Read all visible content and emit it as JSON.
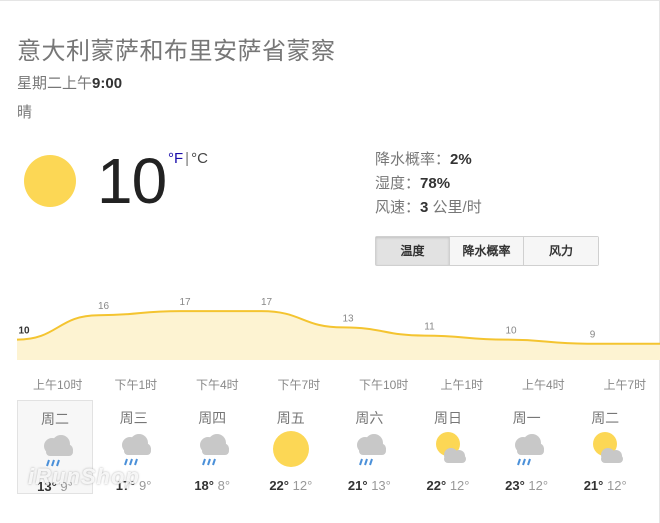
{
  "location": "意大利蒙萨和布里安萨省蒙察",
  "datetime": {
    "prefix": "星期二上午",
    "time": "9:00"
  },
  "condition": "晴",
  "current": {
    "icon": "sun-icon",
    "temperature": "10",
    "unit_f": "°F",
    "unit_sep": "|",
    "unit_c": "°C"
  },
  "details": {
    "precip_label": "降水概率：",
    "precip_value": "2%",
    "humidity_label": "湿度：",
    "humidity_value": "78%",
    "wind_label": "风速：",
    "wind_value": "3",
    "wind_unit": "公里/时"
  },
  "tabs": [
    "温度",
    "降水概率",
    "风力"
  ],
  "active_tab": "温度",
  "chart_data": {
    "type": "area",
    "x": [
      "上午10时",
      "下午1时",
      "下午4时",
      "下午7时",
      "下午10时",
      "上午1时",
      "上午4时",
      "上午7时"
    ],
    "y_points": [
      10,
      16,
      17,
      17,
      13,
      11,
      10,
      9
    ],
    "y_labels": [
      "10",
      "16",
      "17",
      "17",
      "13",
      "11",
      "10",
      "9"
    ],
    "hour_labels": [
      "上午10时",
      "下午1时",
      "下午4时",
      "下午7时",
      "下午10时",
      "上午1时",
      "上午4时",
      "上午7时"
    ],
    "colors": {
      "line": "#f4c430",
      "fill": "#fdf3d2"
    }
  },
  "forecast": [
    {
      "day": "周二",
      "icon": "rain-cloud-icon",
      "hi": "13°",
      "lo": "9°"
    },
    {
      "day": "周三",
      "icon": "rain-cloud-icon",
      "hi": "17°",
      "lo": "9°"
    },
    {
      "day": "周四",
      "icon": "rain-cloud-icon",
      "hi": "18°",
      "lo": "8°"
    },
    {
      "day": "周五",
      "icon": "sun-icon",
      "hi": "22°",
      "lo": "12°"
    },
    {
      "day": "周六",
      "icon": "rain-cloud-icon",
      "hi": "21°",
      "lo": "13°"
    },
    {
      "day": "周日",
      "icon": "partly-cloudy-icon",
      "hi": "22°",
      "lo": "12°"
    },
    {
      "day": "周一",
      "icon": "rain-cloud-icon",
      "hi": "23°",
      "lo": "12°"
    },
    {
      "day": "周二",
      "icon": "partly-cloudy-icon",
      "hi": "21°",
      "lo": "12°"
    }
  ],
  "watermark": "iRunShop",
  "colors": {
    "sun": "#fcd755",
    "cloud": "#c8c8c8",
    "rain": "#4a90d9"
  }
}
